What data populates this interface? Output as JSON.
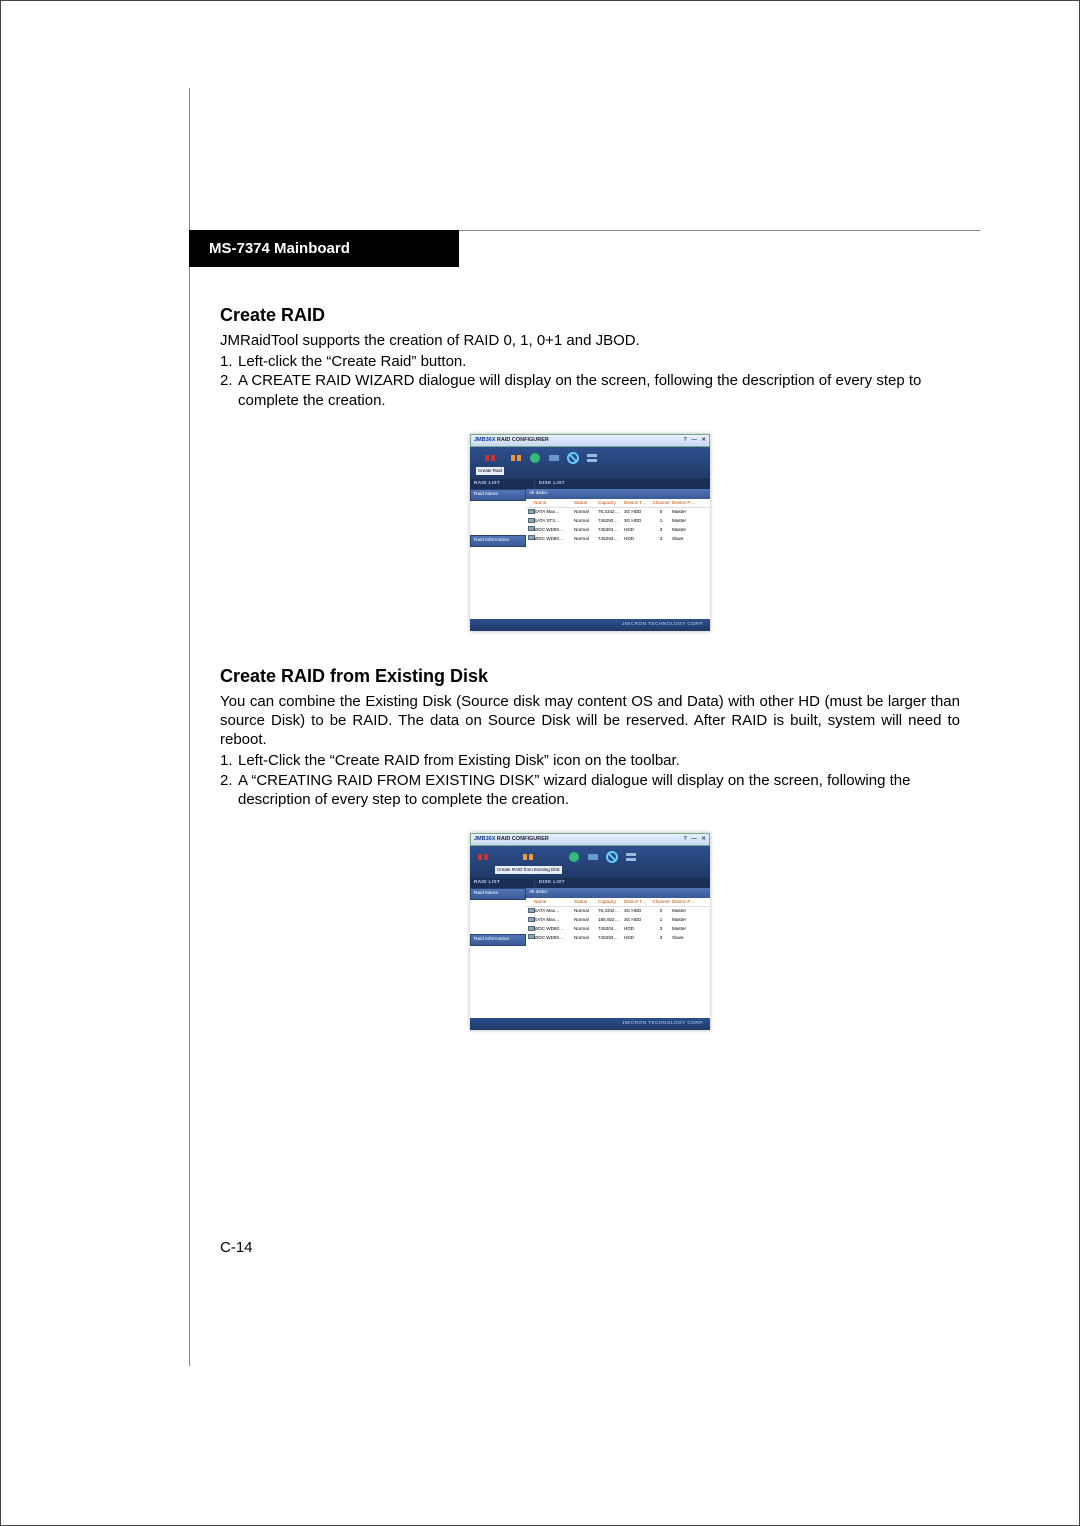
{
  "header": {
    "title": "MS-7374 Mainboard"
  },
  "section1": {
    "title": "Create RAID",
    "intro": "JMRaidTool supports the creation of RAID 0, 1, 0+1 and JBOD.",
    "step1": "Left-click the “Create Raid” button.",
    "step2": "A CREATE RAID WIZARD dialogue will display on the screen, following the description of every step to complete the creation."
  },
  "section2": {
    "title": "Create RAID from Existing Disk",
    "intro": "You can combine the Existing Disk (Source disk may content OS and Data) with other HD (must be larger than source Disk) to be RAID. The data on Source Disk will be reserved. After RAID is built, system will need to reboot.",
    "step1": "Left-Click the “Create RAID from Existing Disk” icon on the toolbar.",
    "step2": "A “CREATING RAID FROM EXISTING DISK” wizard dialogue will display on the screen, following the description of every step to complete the creation."
  },
  "page_number": "C-14",
  "app": {
    "title_brand": "JMB36X",
    "title_rest": " RAID CONFIGURER",
    "tooltip1": "Create Raid",
    "tooltip2": "Create RAID from Existing Disk",
    "raid_list": "Raid List",
    "disk_list": "Disk List",
    "raid_name": "Raid Name",
    "raid_info": "Raid Information",
    "all_disks": "All disks:",
    "footer": "JMicron Technology Corp.",
    "cols": {
      "name": "Name",
      "status": "Status",
      "capacity": "Capacity",
      "device_t": "Device T…",
      "channel": "Channel",
      "device_p": "Device P…"
    }
  },
  "disks1": [
    {
      "name": "SATA  Max…",
      "status": "Normal",
      "capacity": "76,3342…",
      "dt": "3G HDD",
      "ch": "0",
      "dp": "Master"
    },
    {
      "name": "SATA  ST3…",
      "status": "Normal",
      "capacity": "745293…",
      "dt": "3G HDD",
      "ch": "1",
      "dp": "Master"
    },
    {
      "name": "WDC WD80…",
      "status": "Normal",
      "capacity": "745304…",
      "dt": "HDD",
      "ch": "3",
      "dp": "Master"
    },
    {
      "name": "WDC WD80…",
      "status": "Normal",
      "capacity": "745293…",
      "dt": "HDD",
      "ch": "3",
      "dp": "Slave"
    }
  ],
  "disks2": [
    {
      "name": "SATA  Max…",
      "status": "Normal",
      "capacity": "76,3342…",
      "dt": "3G HDD",
      "ch": "0",
      "dp": "Master"
    },
    {
      "name": "SATA  Max…",
      "status": "Normal",
      "capacity": "185,922…",
      "dt": "3G HDD",
      "ch": "1",
      "dp": "Master"
    },
    {
      "name": "WDC WD80…",
      "status": "Normal",
      "capacity": "745304…",
      "dt": "HDD",
      "ch": "3",
      "dp": "Master"
    },
    {
      "name": "WDC WD80…",
      "status": "Normal",
      "capacity": "745293…",
      "dt": "HDD",
      "ch": "3",
      "dp": "Slave"
    }
  ]
}
